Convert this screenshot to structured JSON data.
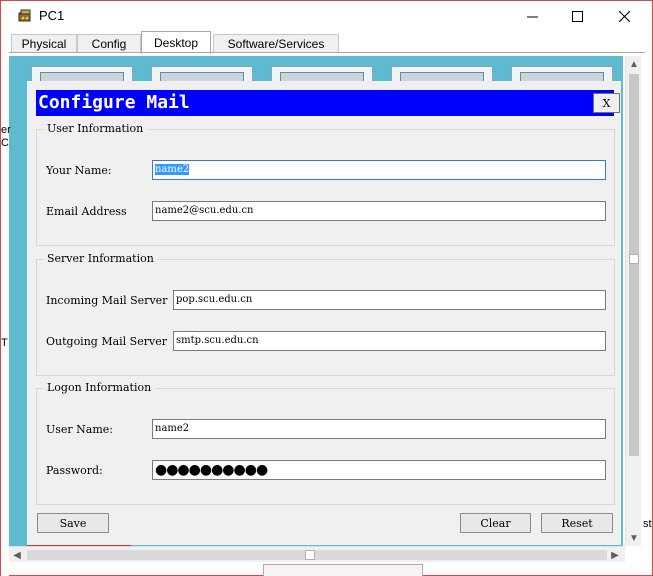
{
  "window": {
    "title": "PC1",
    "app_icon": "network-device-icon",
    "controls": {
      "minimize": "minimize-icon",
      "maximize": "maximize-icon",
      "close": "close-icon"
    }
  },
  "tabs": [
    {
      "label": "Physical",
      "active": false
    },
    {
      "label": "Config",
      "active": false
    },
    {
      "label": "Desktop",
      "active": true
    },
    {
      "label": "Software/Services",
      "active": false
    }
  ],
  "edge_fragments": [
    "er",
    "C",
    "T",
    "st"
  ],
  "dialog": {
    "title": "Configure Mail",
    "close_label": "X",
    "user_info": {
      "legend": "User Information",
      "name_label": "Your Name:",
      "name_value": "name2",
      "email_label": "Email Address",
      "email_value": "name2@scu.edu.cn"
    },
    "server_info": {
      "legend": "Server Information",
      "incoming_label": "Incoming Mail Server",
      "incoming_value": "pop.scu.edu.cn",
      "outgoing_label": "Outgoing Mail Server",
      "outgoing_value": "smtp.scu.edu.cn"
    },
    "logon_info": {
      "legend": "Logon Information",
      "username_label": "User Name:",
      "username_value": "name2",
      "password_label": "Password:",
      "password_mask": "●●●●●●●●●●"
    },
    "buttons": {
      "save": "Save",
      "clear": "Clear",
      "reset": "Reset"
    }
  },
  "colors": {
    "dialog_titlebar": "#0000ff",
    "desktop_background": "#5dbad1",
    "selection_highlight": "#3399ff"
  }
}
